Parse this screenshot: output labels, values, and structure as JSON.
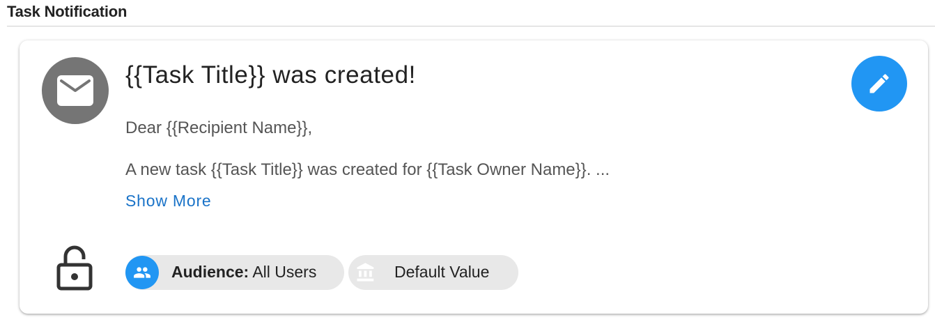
{
  "header": {
    "title": "Task Notification"
  },
  "notification": {
    "title": "{{Task Title}} was created!",
    "greeting": "Dear {{Recipient Name}},",
    "body": "A new task {{Task Title}} was created for {{Task Owner Name}}. ...",
    "show_more_label": "Show More"
  },
  "chips": {
    "audience_label": "Audience:",
    "audience_value": "All Users",
    "default_label": "Default Value"
  },
  "icons": {
    "avatar": "email-icon",
    "edit": "pencil-icon",
    "lock": "lock-open-icon",
    "audience": "people-icon",
    "default": "bank-icon"
  },
  "colors": {
    "accent": "#2196f3",
    "link": "#1a73c8",
    "avatar_bg": "#757575",
    "chip_bg": "#e8e8e8"
  }
}
